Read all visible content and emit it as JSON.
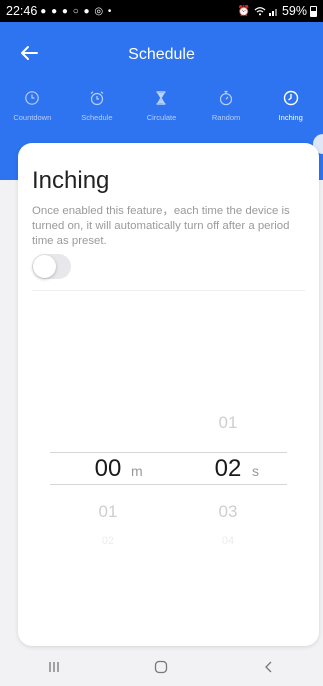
{
  "status_bar": {
    "time": "22:46",
    "notification_icons": [
      "chat-icon",
      "chat-icon",
      "chat-icon",
      "circle-icon",
      "account-icon",
      "instagram-icon",
      "dot-icon"
    ],
    "right_icons": [
      "alarm-icon",
      "wifi-icon",
      "signal-icon"
    ],
    "battery": "59%"
  },
  "header": {
    "title": "Schedule",
    "tabs": [
      {
        "label": "Countdown",
        "icon": "clock-icon",
        "active": false
      },
      {
        "label": "Schedule",
        "icon": "alarm-clock-icon",
        "active": false
      },
      {
        "label": "Circulate",
        "icon": "hourglass-icon",
        "active": false
      },
      {
        "label": "Random",
        "icon": "stopwatch-icon",
        "active": false
      },
      {
        "label": "Inching",
        "icon": "clock-icon",
        "active": true
      }
    ]
  },
  "card": {
    "title": "Inching",
    "description": "Once enabled this feature，each time the device is turned on, it will automatically turn off after a period time as preset.",
    "toggle_on": false
  },
  "picker": {
    "minutes": {
      "above": "",
      "selected": "00",
      "below": "01",
      "below2": "02",
      "unit": "m"
    },
    "seconds": {
      "above": "01",
      "selected": "02",
      "below": "03",
      "below2": "04",
      "unit": "s"
    }
  },
  "nav_bar": [
    "recent-apps-icon",
    "home-icon",
    "back-icon"
  ],
  "colors": {
    "accent": "#2e73f0",
    "background": "#f2f2f5"
  }
}
